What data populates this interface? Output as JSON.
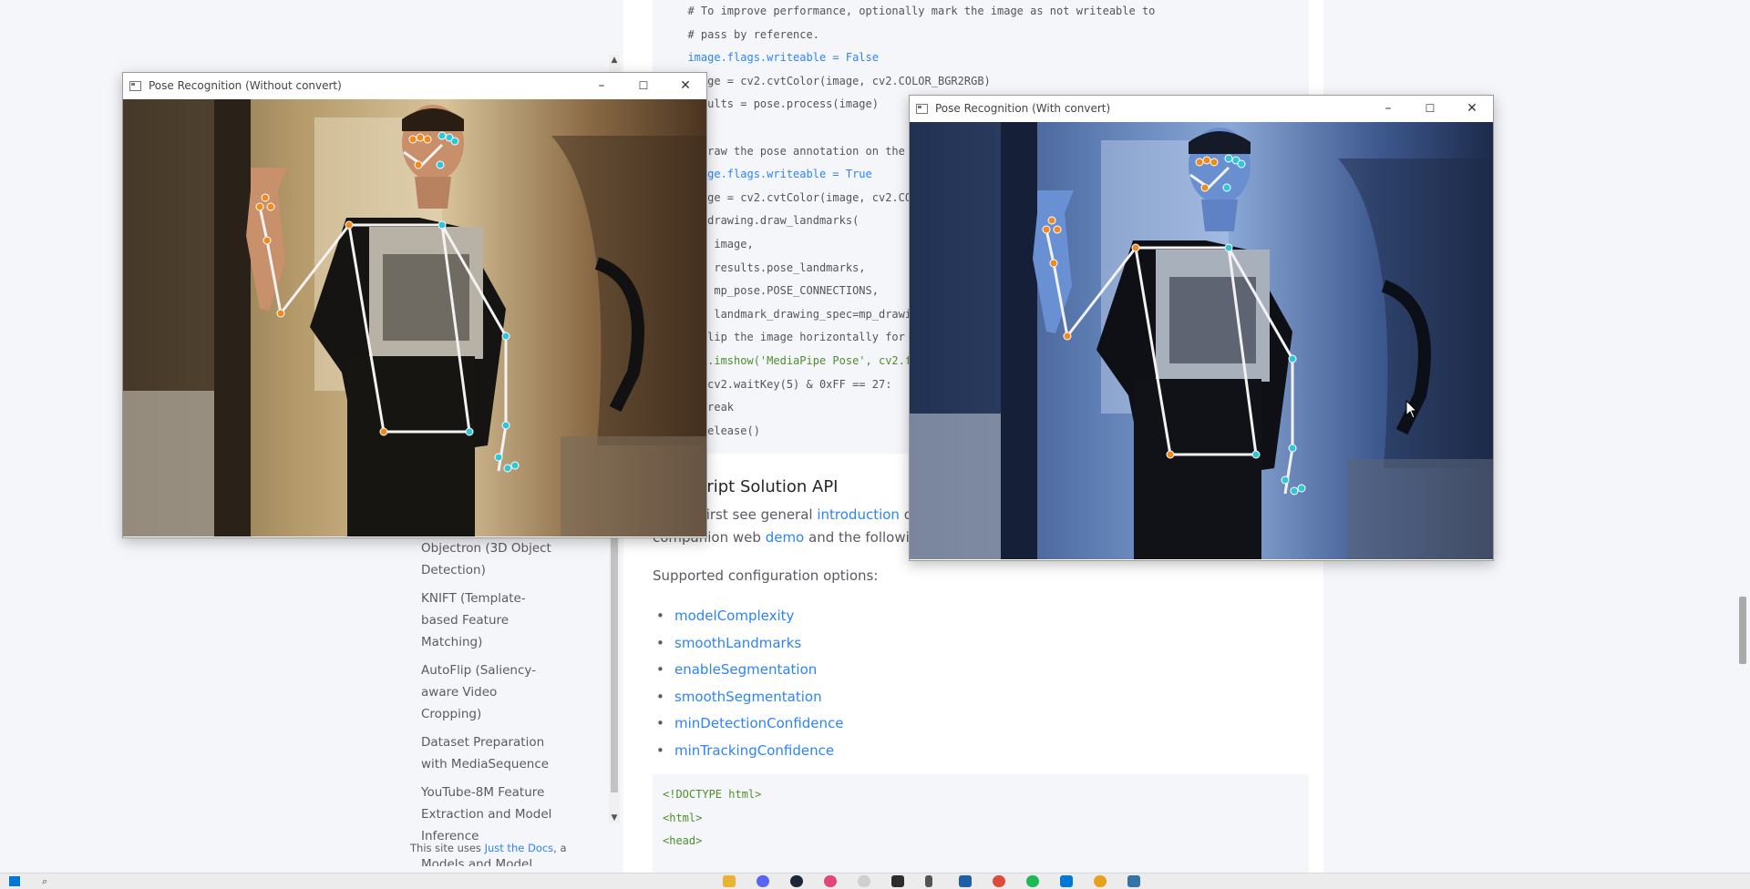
{
  "sidebar": {
    "items": [
      "Objectron (3D Object Detection)",
      "KNIFT (Template-based Feature Matching)",
      "AutoFlip (Saliency-aware Video Cropping)",
      "Dataset Preparation with MediaSequence",
      "YouTube-8M Feature Extraction and Model Inference",
      "Models and Model Cards"
    ],
    "footer_prefix": "This site uses",
    "footer_link": "Just the Docs",
    "footer_suffix": ", a"
  },
  "code_top": [
    "  # To improve performance, optionally mark the image as not writeable to",
    "  # pass by reference.",
    "  image.flags.writeable = False",
    "  image = cv2.cvtColor(image, cv2.COLOR_BGR2RGB)",
    "  results = pose.process(image)",
    "",
    "  # Draw the pose annotation on the image.",
    "  image.flags.writeable = True",
    "  image = cv2.cvtColor(image, cv2.COLOR_RGB2BGR)",
    "  mp_drawing.draw_landmarks(",
    "      image,",
    "      results.pose_landmarks,",
    "      mp_pose.POSE_CONNECTIONS,",
    "      landmark_drawing_spec=mp_drawing_styles.get_default_pose_landmarks_style())",
    "  # Flip the image horizontally for a selfie-view display.",
    "  cv2.imshow('MediaPipe Pose', cv2.flip(image, 1))",
    "  if cv2.waitKey(5) & 0xFF == 27:",
    "    break",
    "cap.release()"
  ],
  "section": {
    "heading": "JavaScript Solution API",
    "intro_prefix": "Please first see general",
    "intro_link": "introduction",
    "intro_suffix": "on MediaPipe in JavaScript, then learn more in the companion web",
    "demo_link": "demo",
    "demo_suffix": "and the following usage example.",
    "supported": "Supported configuration options:",
    "options": [
      "modelComplexity",
      "smoothLandmarks",
      "enableSegmentation",
      "smoothSegmentation",
      "minDetectionConfidence",
      "minTrackingConfidence"
    ]
  },
  "code_bottom": [
    "<!DOCTYPE html>",
    "<html>",
    "<head>"
  ],
  "windows": {
    "left": {
      "title": "Pose Recognition (Without convert)",
      "minimize": "–",
      "maximize": "☐",
      "close": "✕"
    },
    "right": {
      "title": "Pose Recognition (With convert)",
      "minimize": "–",
      "maximize": "☐",
      "close": "✕"
    }
  },
  "colors": {
    "link": "#2c84fa",
    "landmark_left": "#f08a1c",
    "landmark_right": "#2ec7d9",
    "connection": "#f2f2f2"
  },
  "taskbar": {
    "icons": [
      "file-explorer-icon",
      "discord-icon",
      "steam-icon",
      "app-icon",
      "settings-icon",
      "terminal-icon",
      "audio-icon",
      "blender-icon",
      "chrome-icon",
      "spotify-icon",
      "vscode-icon",
      "app2-icon",
      "python-icon"
    ]
  }
}
